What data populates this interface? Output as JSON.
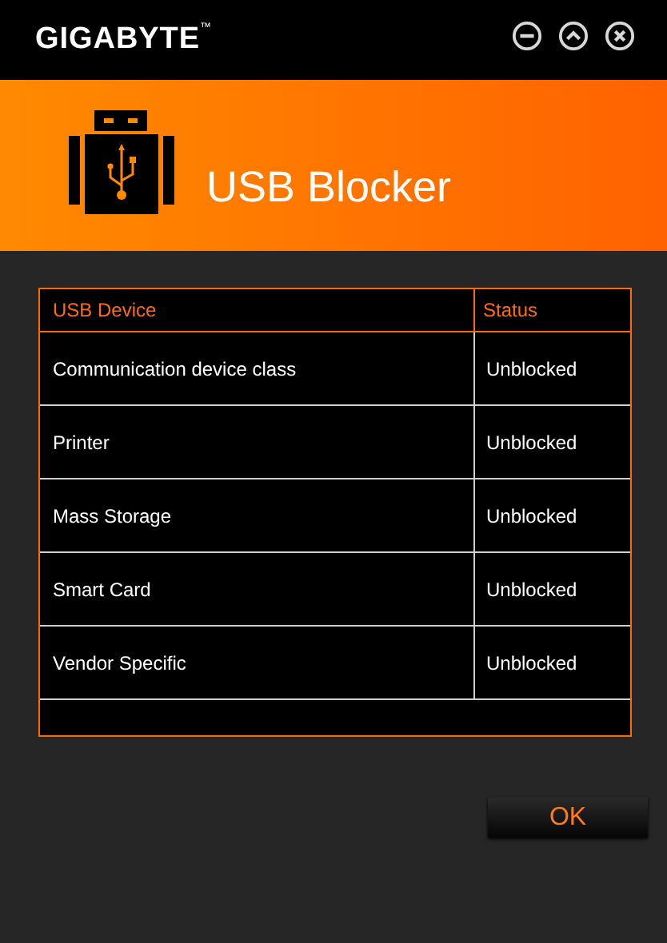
{
  "window": {
    "brand": "GIGABYTE",
    "trademark": "™",
    "title": "USB Blocker"
  },
  "table": {
    "columns": [
      "USB Device",
      "Status"
    ],
    "rows": [
      {
        "device": "Communication device class",
        "status": "Unblocked"
      },
      {
        "device": "Printer",
        "status": "Unblocked"
      },
      {
        "device": "Mass Storage",
        "status": "Unblocked"
      },
      {
        "device": "Smart Card",
        "status": "Unblocked"
      },
      {
        "device": "Vendor Specific",
        "status": "Unblocked"
      }
    ]
  },
  "buttons": [
    "OK"
  ]
}
